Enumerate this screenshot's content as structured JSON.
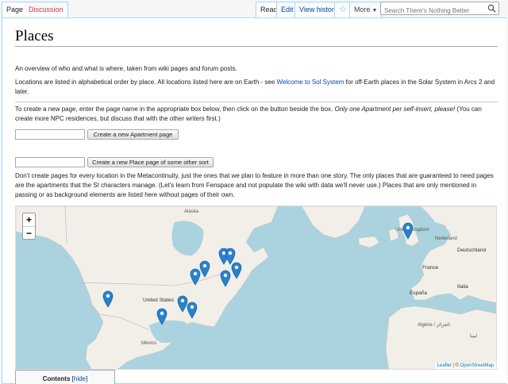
{
  "tabs": {
    "page": "Page",
    "discussion": "Discussion",
    "read": "Read",
    "edit": "Edit",
    "history": "View history",
    "star": "☆",
    "more": "More"
  },
  "search": {
    "placeholder": "Search There's Nothing Better"
  },
  "title": "Places",
  "intro": {
    "p1": "An overview of who and what is where, taken from wiki pages and forum posts.",
    "p2_before": "Locations are listed in alphabetical order by place. All locations listed here are on Earth - see ",
    "p2_link": "Welcome to Sol System",
    "p2_after": " for off-Earth places in the Solar System in Arcs 2 and later.",
    "p3_normal": "To create a new page, enter the page name in the appropriate box below, then click on the button beside the box. ",
    "p3_italic": "Only one Apartment per self-insert, please!",
    "p3_after": " (You can create more NPC residences, but discuss that with the other writers first.)",
    "p4": "Don't create pages for every location in the Metacontinuity, just the ones that we plan to feature in more than one story. The only places that are guaranteed to need pages are the apartments that the SI characters manage. (Let's learn from Fenspace and not populate the wiki with data we'll never use.) Places that are only mentioned in passing or as background elements are listed here without pages of their own."
  },
  "create": {
    "apartment_button": "Create a new Apartment page",
    "place_button": "Create a new Place page of some other sort",
    "apartment_value": "",
    "place_value": ""
  },
  "map": {
    "zoom_in": "+",
    "zoom_out": "−",
    "attribution_leaflet": "Leaflet",
    "attribution_sep": " | © ",
    "attribution_osm": "OpenStreetMap",
    "labels": {
      "alaska": "Alaska",
      "united_states": "United States",
      "mexico": "México",
      "united_kingdom": "United Kingdom",
      "deutschland": "Deutschland",
      "france": "France",
      "espana": "España",
      "italia": "Italia",
      "algerie": "Algérie / الجزائر",
      "nederland": "Nederland",
      "libya": "ليبيا"
    },
    "colors": {
      "water": "#aad3df",
      "land": "#f2efe9",
      "pin": "#2a81cb"
    }
  },
  "toc": {
    "title": "Contents",
    "hide": "hide"
  }
}
